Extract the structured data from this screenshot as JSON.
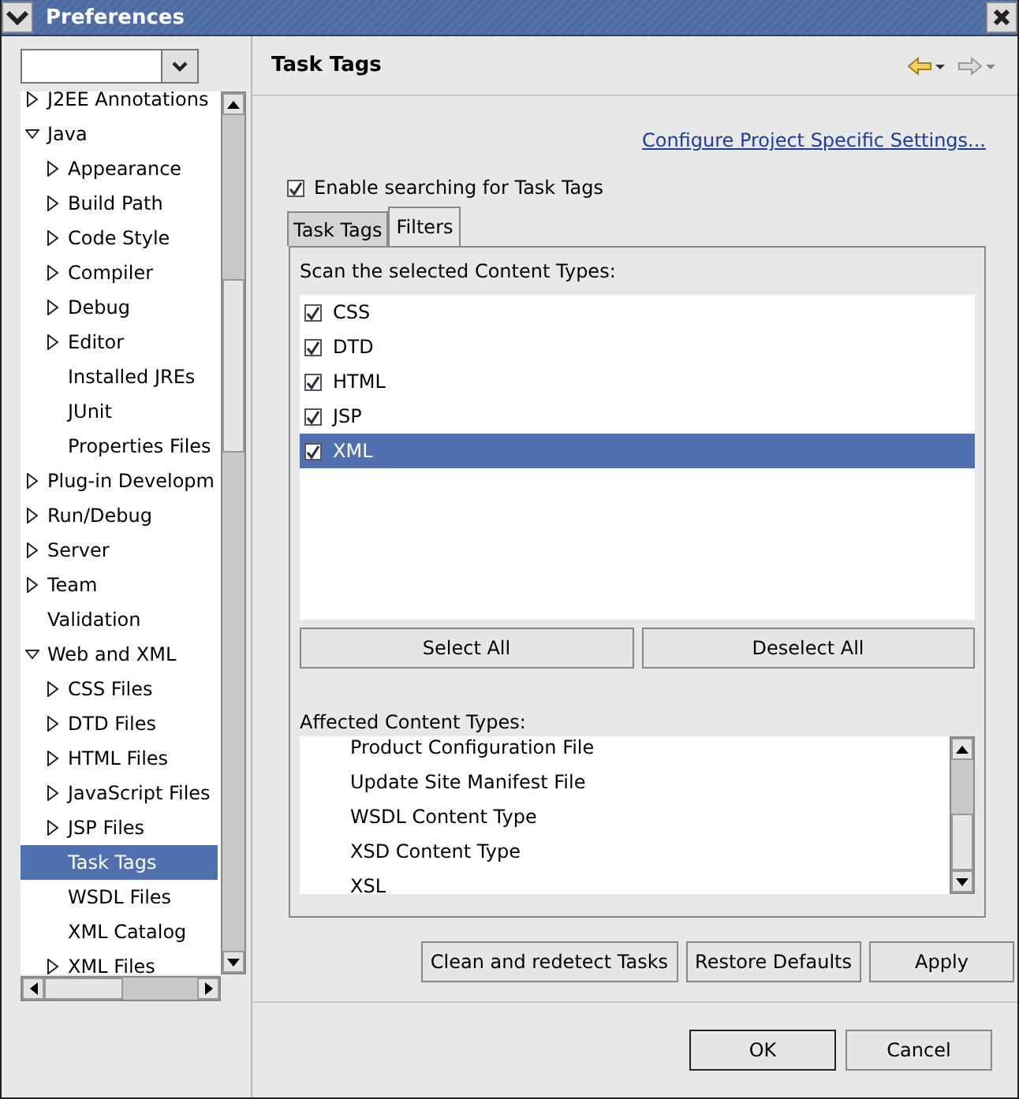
{
  "window": {
    "title": "Preferences"
  },
  "sidebar": {
    "tree": [
      {
        "label": "J2EE Annotations",
        "expanded": false,
        "selected": false
      },
      {
        "label": "Java",
        "expanded": true,
        "selected": false,
        "children": [
          {
            "label": "Appearance",
            "expanded": false,
            "selected": false
          },
          {
            "label": "Build Path",
            "expanded": false,
            "selected": false
          },
          {
            "label": "Code Style",
            "expanded": false,
            "selected": false
          },
          {
            "label": "Compiler",
            "expanded": false,
            "selected": false
          },
          {
            "label": "Debug",
            "expanded": false,
            "selected": false
          },
          {
            "label": "Editor",
            "expanded": false,
            "selected": false
          },
          {
            "label": "Installed JREs",
            "selected": false
          },
          {
            "label": "JUnit",
            "selected": false
          },
          {
            "label": "Properties Files",
            "selected": false
          }
        ]
      },
      {
        "label": "Plug-in Developm",
        "expanded": false,
        "selected": false
      },
      {
        "label": "Run/Debug",
        "expanded": false,
        "selected": false
      },
      {
        "label": "Server",
        "expanded": false,
        "selected": false
      },
      {
        "label": "Team",
        "expanded": false,
        "selected": false
      },
      {
        "label": "Validation",
        "selected": false
      },
      {
        "label": "Web and XML",
        "expanded": true,
        "selected": false,
        "children": [
          {
            "label": "CSS Files",
            "expanded": false,
            "selected": false
          },
          {
            "label": "DTD Files",
            "expanded": false,
            "selected": false
          },
          {
            "label": "HTML Files",
            "expanded": false,
            "selected": false
          },
          {
            "label": "JavaScript Files",
            "expanded": false,
            "selected": false
          },
          {
            "label": "JSP Files",
            "expanded": false,
            "selected": false
          },
          {
            "label": "Task Tags",
            "selected": true
          },
          {
            "label": "WSDL Files",
            "selected": false
          },
          {
            "label": "XML Catalog",
            "selected": false
          },
          {
            "label": "XML Files",
            "expanded": false,
            "selected": false
          }
        ]
      }
    ]
  },
  "page": {
    "title": "Task Tags",
    "link": "Configure Project Specific Settings...",
    "enable": {
      "label": "Enable searching for Task Tags",
      "checked": true
    },
    "tabs": [
      {
        "label": "Task Tags",
        "selected": false
      },
      {
        "label": "Filters",
        "selected": true
      }
    ],
    "scan_label": "Scan the selected Content Types:",
    "content_types": [
      {
        "label": "CSS",
        "checked": true,
        "selected": false
      },
      {
        "label": "DTD",
        "checked": true,
        "selected": false
      },
      {
        "label": "HTML",
        "checked": true,
        "selected": false
      },
      {
        "label": "JSP",
        "checked": true,
        "selected": false
      },
      {
        "label": "XML",
        "checked": true,
        "selected": true
      }
    ],
    "list_buttons": [
      "Select All",
      "Deselect All"
    ],
    "affected_label": "Affected Content Types:",
    "affected": [
      "Product Configuration File",
      "Update Site Manifest File",
      "WSDL Content Type",
      "XSD Content Type",
      "XSL"
    ],
    "page_buttons": [
      {
        "label": "Clean and redetect Tasks"
      },
      {
        "label": "Restore Defaults"
      },
      {
        "label": "Apply"
      }
    ]
  },
  "buttons": [
    {
      "label": "OK",
      "default": true
    },
    {
      "label": "Cancel",
      "default": false
    }
  ]
}
